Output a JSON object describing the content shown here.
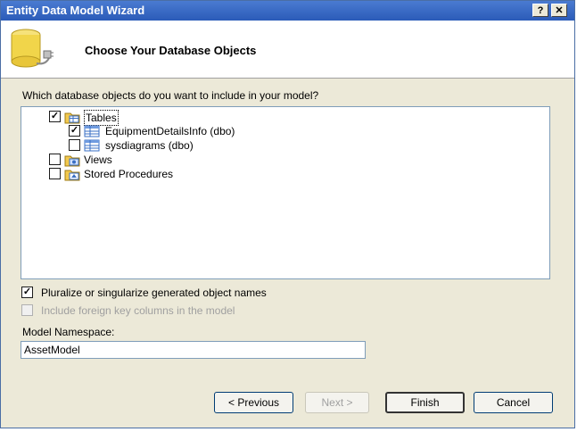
{
  "window": {
    "title": "Entity Data Model Wizard",
    "help_label": "?",
    "close_label": "✕"
  },
  "header": {
    "title": "Choose Your Database Objects",
    "icon": "database-plug-icon"
  },
  "question": "Which database objects do you want to include in your model?",
  "tree": {
    "tables": {
      "label": "Tables",
      "checked": true,
      "icon": "tables-folder-icon"
    },
    "table_items": [
      {
        "label": "EquipmentDetailsInfo (dbo)",
        "checked": true,
        "icon": "table-icon"
      },
      {
        "label": "sysdiagrams (dbo)",
        "checked": false,
        "icon": "table-icon"
      }
    ],
    "views": {
      "label": "Views",
      "checked": false,
      "icon": "views-folder-icon"
    },
    "procs": {
      "label": "Stored Procedures",
      "checked": false,
      "icon": "procedures-folder-icon"
    }
  },
  "options": {
    "pluralize": {
      "label": "Pluralize or singularize generated object names",
      "checked": true
    },
    "foreign_keys": {
      "label": "Include foreign key columns in the model",
      "checked": false,
      "enabled": false
    }
  },
  "namespace": {
    "label": "Model Namespace:",
    "value": "AssetModel"
  },
  "buttons": {
    "previous": "< Previous",
    "next": "Next >",
    "finish": "Finish",
    "cancel": "Cancel"
  },
  "check_mark": "✓"
}
